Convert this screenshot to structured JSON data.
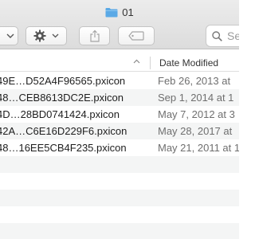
{
  "window": {
    "title": "01"
  },
  "toolbar": {
    "view_icon": "view-options-chevron-icon",
    "action_icon": "gear-icon",
    "share_icon": "share-icon",
    "tags_icon": "tag-icon",
    "search_placeholder": "Se"
  },
  "columns": {
    "date_modified": "Date Modified"
  },
  "rows": [
    {
      "name": "49E…D52A4F96565.pxicon",
      "date": "Feb 26, 2013 at"
    },
    {
      "name": "48…CEB8613DC2E.pxicon",
      "date": "Sep 1, 2014 at 1"
    },
    {
      "name": "4D…28BD0741424.pxicon",
      "date": "May 7, 2012 at 3"
    },
    {
      "name": "42A…C6E16D229F6.pxicon",
      "date": "May 28, 2017 at"
    },
    {
      "name": "48…16EE5CB4F235.pxicon",
      "date": "May 21, 2011 at 1"
    }
  ],
  "colors": {
    "toolbar_bg": "#e3e3e3",
    "folder_blue": "#5aa9e6",
    "row_alt": "#f4f5f5",
    "date_text": "#6f6f6f"
  }
}
